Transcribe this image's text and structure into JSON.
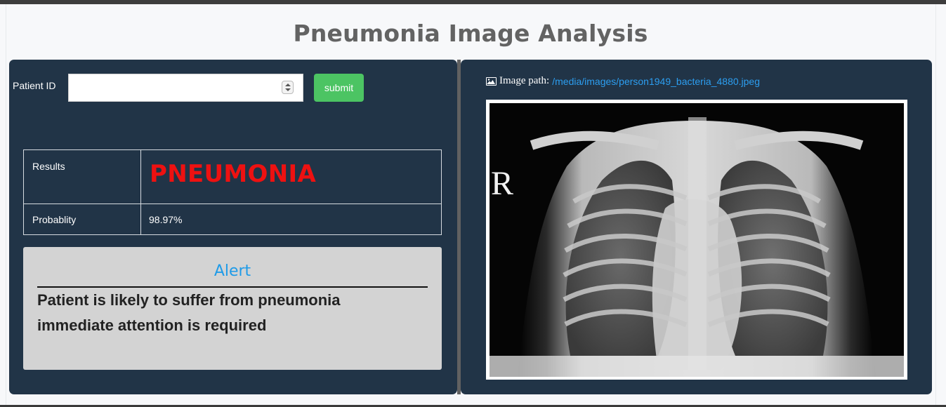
{
  "page": {
    "title": "Pneumonia Image Analysis"
  },
  "form": {
    "patient_id_label": "Patient ID",
    "patient_id_value": "",
    "submit_label": "submit"
  },
  "results": {
    "result_label": "Results",
    "result_value": "PNEUMONIA",
    "probability_label": "Probablity",
    "probability_value": "98.97%"
  },
  "alert": {
    "title": "Alert",
    "line1": "Patient is likely to suffer from pneumonia",
    "line2": "immediate attention is required"
  },
  "image": {
    "path_label": "Image path:",
    "path_value": "/media/images/person1949_bacteria_4880.jpeg",
    "xray_marker": "R"
  },
  "colors": {
    "panel": "#213447",
    "result_text": "#ee1111",
    "submit_button": "#4cc463",
    "alert_title": "#1e9be8",
    "link": "#2c9ef0"
  }
}
